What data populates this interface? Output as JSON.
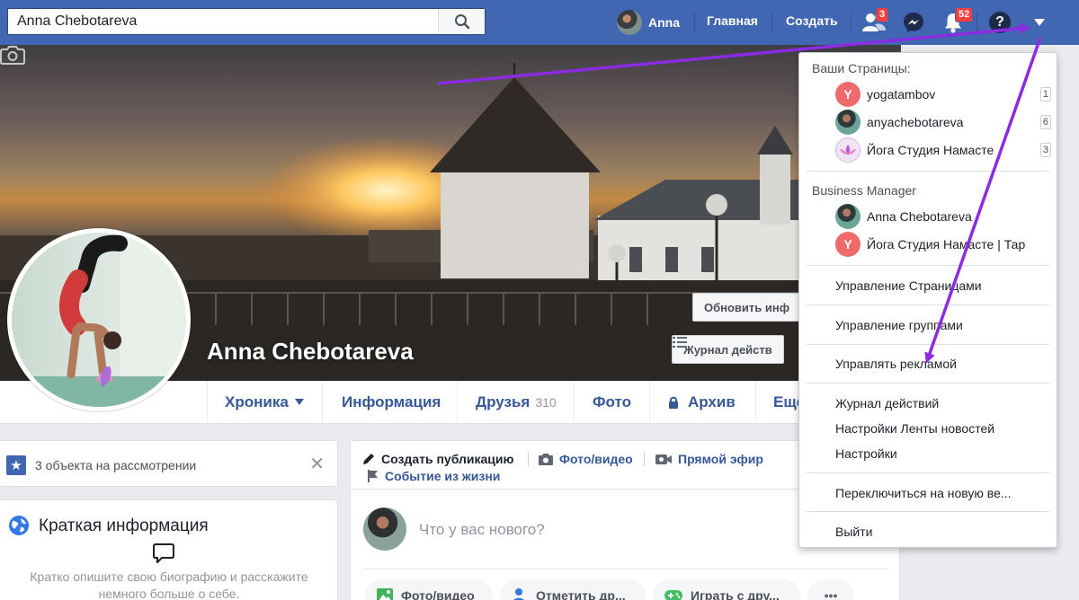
{
  "topbar": {
    "search_value": "Anna Chebotareva",
    "user_name": "Anna",
    "home": "Главная",
    "create": "Создать",
    "friends_badge": "3",
    "notifications_badge": "52",
    "help_icon": "?"
  },
  "profile": {
    "name": "Anna Chebotareva",
    "update_info_button": "Обновить инф",
    "activity_log_button": "Журнал действ"
  },
  "tabs": [
    {
      "label": "Хроника"
    },
    {
      "label": "Информация"
    },
    {
      "label": "Друзья",
      "count": "310"
    },
    {
      "label": "Фото"
    },
    {
      "label": "Архив"
    },
    {
      "label": "Ещё"
    }
  ],
  "review": {
    "text": "3 объекта на рассмотрении",
    "close": "✕"
  },
  "intro": {
    "title": "Краткая информация",
    "description": "Кратко опишите свою биографию и расскажите немного больше о себе."
  },
  "composer": {
    "create_post": "Создать публикацию",
    "photo_video": "Фото/видео",
    "live": "Прямой эфир",
    "life_event": "Событие из жизни",
    "placeholder": "Что у вас нового?",
    "pill_photo": "Фото/видео",
    "pill_tag": "Отметить др...",
    "pill_game": "Играть с дру...",
    "pill_more": "•••"
  },
  "dropdown": {
    "your_pages_header": "Ваши Страницы:",
    "pages": [
      {
        "name": "yogatambov",
        "count": "1",
        "letter": "Y"
      },
      {
        "name": "anyachebotareva",
        "count": "6"
      },
      {
        "name": "Йога Студия Намасте",
        "count": "3"
      }
    ],
    "business_header": "Business Manager",
    "business": [
      {
        "name": "Anna Chebotareva"
      },
      {
        "name": "Йога Студия Намасте | Тар",
        "letter": "Y"
      }
    ],
    "manage_pages": "Управление Страницами",
    "manage_groups": "Управление группами",
    "manage_ads": "Управлять рекламой",
    "activity_log": "Журнал действий",
    "news_feed_settings": "Настройки Ленты новостей",
    "settings": "Настройки",
    "switch_new": "Переключиться на новую ве...",
    "logout": "Выйти"
  },
  "colors": {
    "brand": "#4267b2",
    "link": "#365899",
    "annotation": "#8b2be2"
  }
}
